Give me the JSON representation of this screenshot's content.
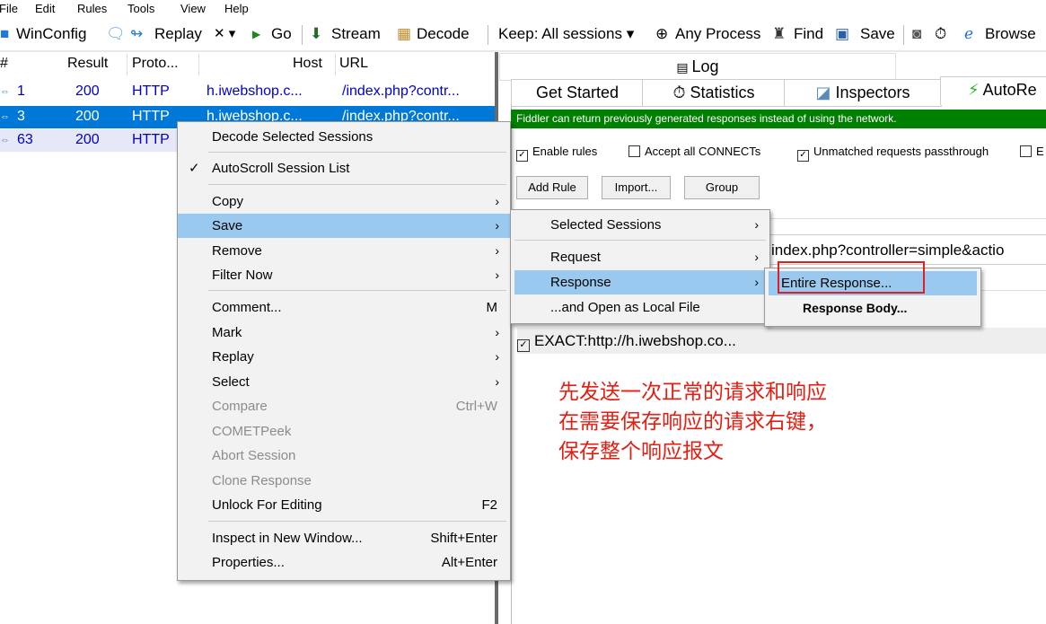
{
  "menubar": [
    "File",
    "Edit",
    "Rules",
    "Tools",
    "View",
    "Help"
  ],
  "toolbar": {
    "winconfig": "WinConfig",
    "replay": "Replay",
    "x_menu": "✕ ▾",
    "go": "Go",
    "stream": "Stream",
    "decode": "Decode",
    "keep": "Keep: All sessions ▾",
    "process": "Any Process",
    "find": "Find",
    "save": "Save",
    "browse": "Browse"
  },
  "columns": {
    "num": "#",
    "result": "Result",
    "protocol": "Proto...",
    "host": "Host",
    "url": "URL"
  },
  "sessions": [
    {
      "num": "1",
      "result": "200",
      "protocol": "HTTP",
      "host": "h.iwebshop.c...",
      "url": "/index.php?contr..."
    },
    {
      "num": "3",
      "result": "200",
      "protocol": "HTTP",
      "host": "h.iwebshop.c...",
      "url": "/index.php?contr..."
    },
    {
      "num": "63",
      "result": "200",
      "protocol": "HTTP",
      "host": "",
      "url": ""
    }
  ],
  "tabs": {
    "log": "Log",
    "get_started": "Get Started",
    "statistics": "Statistics",
    "inspectors": "Inspectors",
    "autoresponder": "AutoRe"
  },
  "autoresponder": {
    "banner": "Fiddler can return previously generated responses instead of using the network.",
    "enable_rules": "Enable rules",
    "accept_connects": "Accept all CONNECTs",
    "unmatched": "Unmatched requests passthrough",
    "add_rule": "Add Rule",
    "import": "Import...",
    "group": "Group",
    "rule_url": "index.php?controller=simple&actio",
    "rule_item": "EXACT:http://h.iwebshop.co..."
  },
  "context_menu": {
    "decode": "Decode Selected Sessions",
    "autoscroll": "AutoScroll Session List",
    "copy": "Copy",
    "save": "Save",
    "remove": "Remove",
    "filter_now": "Filter Now",
    "comment": "Comment...",
    "comment_sc": "M",
    "mark": "Mark",
    "replay": "Replay",
    "select": "Select",
    "compare": "Compare",
    "compare_sc": "Ctrl+W",
    "cometpeek": "COMETPeek",
    "abort": "Abort Session",
    "clone": "Clone Response",
    "unlock": "Unlock For Editing",
    "unlock_sc": "F2",
    "inspect": "Inspect in New Window...",
    "inspect_sc": "Shift+Enter",
    "properties": "Properties...",
    "properties_sc": "Alt+Enter"
  },
  "save_menu": {
    "selected_sessions": "Selected Sessions",
    "request": "Request",
    "response": "Response",
    "open_local": "...and Open as Local File"
  },
  "response_menu": {
    "entire": "Entire Response...",
    "body": "Response Body..."
  },
  "annotation": [
    "先发送一次正常的请求和响应",
    "在需要保存响应的请求右键，",
    "保存整个响应报文"
  ],
  "colors": {
    "selected_row": "#0078d7",
    "menu_highlight": "#99c9ef",
    "banner": "#008000",
    "annotation": "#e31e12",
    "session_text": "#0000cc"
  }
}
